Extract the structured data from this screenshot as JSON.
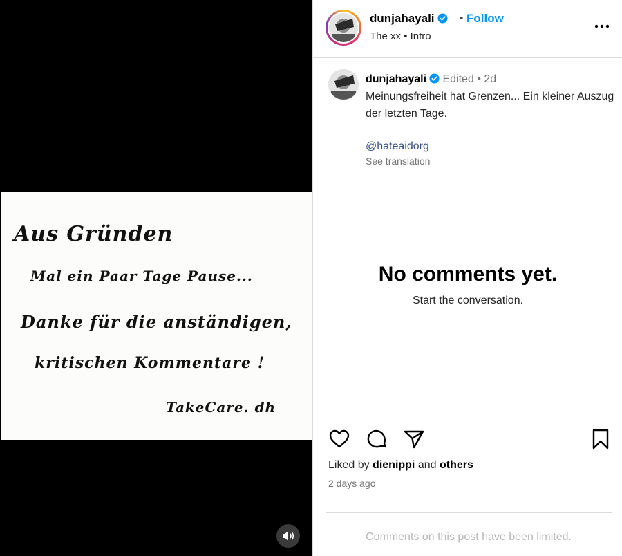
{
  "post": {
    "username": "dunjahayali",
    "follow_label": "Follow",
    "separator": "•",
    "audio": "The xx • Intro",
    "note": {
      "line1": "Aus Gründen",
      "line2": "Mal ein Paar Tage Pause...",
      "line3": "Danke für die anständigen,",
      "line4": "kritischen Kommentare !",
      "line5": "TakeCare. dh"
    }
  },
  "caption": {
    "username": "dunjahayali",
    "edited": "Edited",
    "age": "2d",
    "text": "Meinungsfreiheit hat Grenzen... Ein kleiner Auszug der letzten Tage.",
    "mention": "@hateaidorg",
    "see_translation": "See translation"
  },
  "comments": {
    "empty_title": "No comments yet.",
    "empty_subtitle": "Start the conversation."
  },
  "engagement": {
    "liked_by_prefix": "Liked by",
    "liked_by_user": "dienippi",
    "liked_by_and": "and",
    "liked_by_others": "others",
    "time": "2 days ago"
  },
  "footer": {
    "limited_text": "Comments on this post have been limited."
  },
  "icons": [
    "verified-badge-icon",
    "more-options-icon",
    "heart-icon",
    "comment-icon",
    "share-icon",
    "bookmark-icon",
    "speaker-icon"
  ],
  "colors": {
    "follow": "#0095f6",
    "verified": "#0095f6",
    "mention": "#385185",
    "muted": "#737373"
  }
}
